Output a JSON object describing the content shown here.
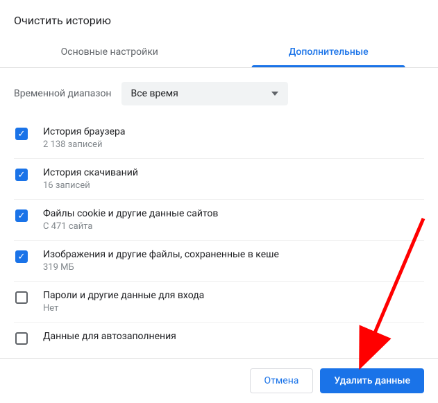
{
  "dialog": {
    "title": "Очистить историю"
  },
  "tabs": {
    "basic": "Основные настройки",
    "advanced": "Дополнительные"
  },
  "timeRange": {
    "label": "Временной диапазон",
    "selected": "Все время"
  },
  "options": [
    {
      "checked": true,
      "title": "История браузера",
      "sub": "2 138 записей"
    },
    {
      "checked": true,
      "title": "История скачиваний",
      "sub": "16 записей"
    },
    {
      "checked": true,
      "title": "Файлы cookie и другие данные сайтов",
      "sub": "С 471 сайта"
    },
    {
      "checked": true,
      "title": "Изображения и другие файлы, сохраненные в кеше",
      "sub": "319 МБ"
    },
    {
      "checked": false,
      "title": "Пароли и другие данные для входа",
      "sub": "Нет"
    },
    {
      "checked": false,
      "title": "Данные для автозаполнения",
      "sub": ""
    }
  ],
  "buttons": {
    "cancel": "Отмена",
    "clear": "Удалить данные"
  },
  "colors": {
    "primary": "#1a73e8",
    "arrow": "#ff0000"
  }
}
